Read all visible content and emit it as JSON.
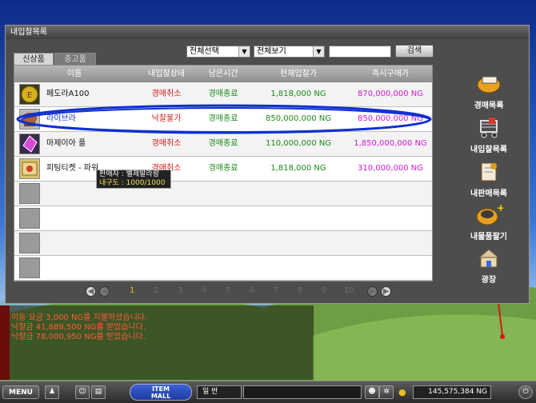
{
  "window": {
    "title": "내입찰목록"
  },
  "tabs": [
    {
      "label": "신상품",
      "active": true
    },
    {
      "label": "중고품",
      "active": false
    }
  ],
  "filters": {
    "category": "전체선택",
    "view": "전체보기",
    "search_value": "",
    "search_label": "검색"
  },
  "table": {
    "headers": [
      "이름",
      "내입찰상태",
      "남은시간",
      "현재입찰가",
      "즉시구매가"
    ],
    "rows": [
      {
        "name": "페도라A100",
        "state": "경매취소",
        "time": "경매종료",
        "bid": "1,818,000 NG",
        "buy": "870,000,000 NG",
        "icon": "coin-item-icon"
      },
      {
        "name": "라이브라",
        "state": "낙찰불가",
        "time": "경매종료",
        "bid": "850,000,000 NG",
        "buy": "850,000,000 NG",
        "icon": "libra-item-icon",
        "highlighted": true
      },
      {
        "name": "마제이아 플",
        "state": "경매취소",
        "time": "경매종료",
        "bid": "110,000,000 NG",
        "buy": "1,850,000,000 NG",
        "icon": "gem-item-icon"
      },
      {
        "name": "피팅티켓 - 파워",
        "state": "경매취소",
        "time": "경매종료",
        "bid": "1,818,000 NG",
        "buy": "310,000,000 NG",
        "icon": "ticket-item-icon"
      }
    ]
  },
  "tooltip": {
    "seller": "판매자 : 벨제발라왕",
    "durability": "내구도 : 1000/1000"
  },
  "pagination": {
    "pages": [
      "1",
      "2",
      "3",
      "4",
      "5",
      "6",
      "7",
      "8",
      "9",
      "10"
    ],
    "current": "1"
  },
  "sidebar": [
    {
      "label": "경매목록",
      "icon": "auction-list-icon"
    },
    {
      "label": "내입찰목록",
      "icon": "cart-icon"
    },
    {
      "label": "내판매목록",
      "icon": "sale-list-icon"
    },
    {
      "label": "내물품팔기",
      "icon": "sell-item-icon"
    },
    {
      "label": "광장",
      "icon": "plaza-icon"
    }
  ],
  "chat": {
    "lines": [
      "이동 요금 3,000 NG를 지불하셨습니다.",
      "낙찰금 41,889,500 NG를 받았습니다.",
      "낙찰금 78,000,950 NG를 받았습니다."
    ]
  },
  "bottom_bar": {
    "menu_label": "MENU",
    "item_mall_line1": "ITEM",
    "item_mall_line2": "MALL",
    "chat_mode": "일      반",
    "money": "145,575,384 NG"
  },
  "colors": {
    "state_red": "#d21a1a",
    "time_green": "#1a8a1a",
    "buy_magenta": "#d21ad2",
    "highlight_blue": "#1030d0"
  }
}
